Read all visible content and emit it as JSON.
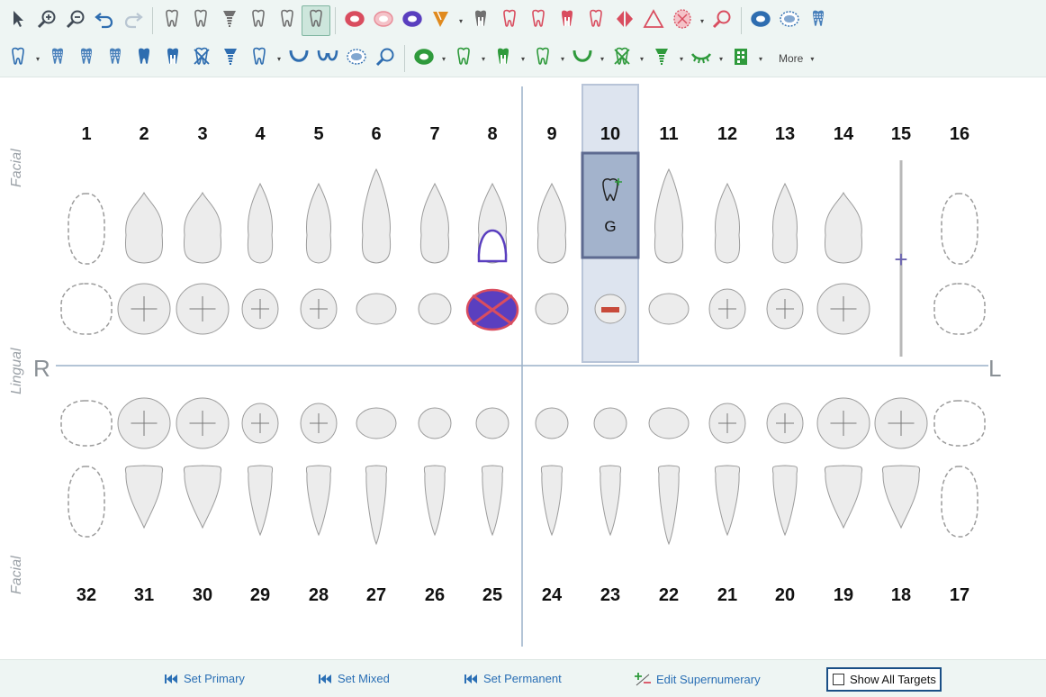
{
  "toolbar": {
    "row1": [
      {
        "icon": "pointer-icon",
        "color": "#404a55"
      },
      {
        "icon": "zoom-in-icon",
        "color": "#404a55"
      },
      {
        "icon": "zoom-out-icon",
        "color": "#404a55"
      },
      {
        "icon": "undo-icon",
        "color": "#2e6db0"
      },
      {
        "icon": "redo-icon",
        "color": "#b9c6d2"
      },
      {
        "sep": true
      },
      {
        "icon": "extract-tooth-icon",
        "color": "#707070"
      },
      {
        "icon": "bridge-icon",
        "color": "#707070"
      },
      {
        "icon": "implant-bridge-icon",
        "color": "#707070"
      },
      {
        "icon": "tooth-outline-icon",
        "color": "#707070"
      },
      {
        "icon": "move-tooth-icon",
        "color": "#707070"
      },
      {
        "icon": "supernumerary-tooth-icon",
        "color": "#707070",
        "active": true
      },
      {
        "sep": true
      },
      {
        "icon": "red-filling-mo-icon",
        "color": "#d94d5f"
      },
      {
        "icon": "red-filling-ring-icon",
        "color": "#e88a96"
      },
      {
        "icon": "blue-filling-icon",
        "color": "#5a3fbf"
      },
      {
        "icon": "sealant-flag-icon",
        "color": "#e08a1e",
        "drop": true
      },
      {
        "icon": "crown-green-icon",
        "color": "#707070"
      },
      {
        "icon": "fractured-tooth-icon",
        "color": "#d94d5f"
      },
      {
        "icon": "broken-tooth-icon",
        "color": "#d94d5f"
      },
      {
        "icon": "root-canal-icon",
        "color": "#d94d5f"
      },
      {
        "icon": "tooth-red-outline-icon",
        "color": "#d94d5f"
      },
      {
        "icon": "diastema-icon",
        "color": "#d94d5f"
      },
      {
        "icon": "triangle-icon",
        "color": "#d94d5f"
      },
      {
        "icon": "cross-tooth-icon",
        "color": "#d94d5f",
        "drop": true
      },
      {
        "icon": "search-red-icon",
        "color": "#d94d5f"
      },
      {
        "sep": true
      },
      {
        "icon": "blue-surface-icon",
        "color": "#2e6db0"
      },
      {
        "icon": "blue-dotted-surface-icon",
        "color": "#2e6db0"
      },
      {
        "icon": "blue-pattern-tooth-icon",
        "color": "#2e6db0"
      }
    ],
    "row2": [
      {
        "icon": "blue-tooth-outline-icon",
        "color": "#2e6db0",
        "drop": true
      },
      {
        "icon": "blue-stripe-tooth-icon",
        "color": "#2e6db0"
      },
      {
        "icon": "blue-wave-tooth-icon",
        "color": "#2e6db0"
      },
      {
        "icon": "blue-grid-tooth-icon",
        "color": "#2e6db0"
      },
      {
        "icon": "blue-solid-tooth-icon",
        "color": "#2e6db0"
      },
      {
        "icon": "blue-crown-icon",
        "color": "#2e6db0"
      },
      {
        "icon": "blue-x-tooth-icon",
        "color": "#2e6db0"
      },
      {
        "icon": "blue-implant-icon",
        "color": "#2e6db0"
      },
      {
        "icon": "blue-molar-icon",
        "color": "#2e6db0",
        "drop": true
      },
      {
        "icon": "blue-arch-icon",
        "color": "#2e6db0"
      },
      {
        "icon": "blue-double-arch-icon",
        "color": "#2e6db0"
      },
      {
        "icon": "blue-dotted-oval-icon",
        "color": "#2e6db0"
      },
      {
        "icon": "search-blue-icon",
        "color": "#2e6db0"
      },
      {
        "sep": true
      },
      {
        "icon": "green-surface-icon",
        "color": "#2f9a3c",
        "drop": true
      },
      {
        "icon": "green-tooth-icon",
        "color": "#2f9a3c",
        "drop": true
      },
      {
        "icon": "green-crown-icon",
        "color": "#2f9a3c",
        "drop": true
      },
      {
        "icon": "green-molar-icon",
        "color": "#2f9a3c",
        "drop": true
      },
      {
        "icon": "green-arch-icon",
        "color": "#2f9a3c",
        "drop": true
      },
      {
        "icon": "green-x-tooth-icon",
        "color": "#2f9a3c",
        "drop": true
      },
      {
        "icon": "green-implant-icon",
        "color": "#2f9a3c",
        "drop": true
      },
      {
        "icon": "green-eyelash-icon",
        "color": "#2f9a3c",
        "drop": true
      },
      {
        "icon": "green-grid-icon",
        "color": "#2f9a3c",
        "drop": true
      }
    ],
    "more_label": "More"
  },
  "chart": {
    "side_labels": {
      "facial_top": "Facial",
      "lingual": "Lingual",
      "facial_bottom": "Facial"
    },
    "right_label": "R",
    "left_label": "L",
    "upper_numbers": [
      "1",
      "2",
      "3",
      "4",
      "5",
      "6",
      "7",
      "8",
      "9",
      "10",
      "11",
      "12",
      "13",
      "14",
      "15",
      "16"
    ],
    "lower_numbers": [
      "32",
      "31",
      "30",
      "29",
      "28",
      "27",
      "26",
      "25",
      "24",
      "23",
      "22",
      "21",
      "20",
      "19",
      "18",
      "17"
    ],
    "selected_tooth": "10",
    "selected_condition_label": "G",
    "supernumerary_marker": "+",
    "colors": {
      "tooth_fill": "#ececec",
      "tooth_stroke": "#9c9c9c",
      "missing_stroke": "#9c9c9c",
      "restoration_purple": "#5a3fbf",
      "restoration_red": "#d94d5f",
      "selection_fill": "#dde4ef",
      "selection_stroke": "#b8c4d8",
      "selected_cell_fill": "#a3b3cc",
      "selected_cell_stroke": "#5d6a90",
      "midline": "#9ab0c8",
      "lesion": "#c84a3a"
    }
  },
  "footer": {
    "set_primary": "Set Primary",
    "set_mixed": "Set Mixed",
    "set_permanent": "Set Permanent",
    "edit_supernumerary": "Edit Supernumerary",
    "show_all_targets": "Show All Targets",
    "show_all_targets_checked": false
  }
}
